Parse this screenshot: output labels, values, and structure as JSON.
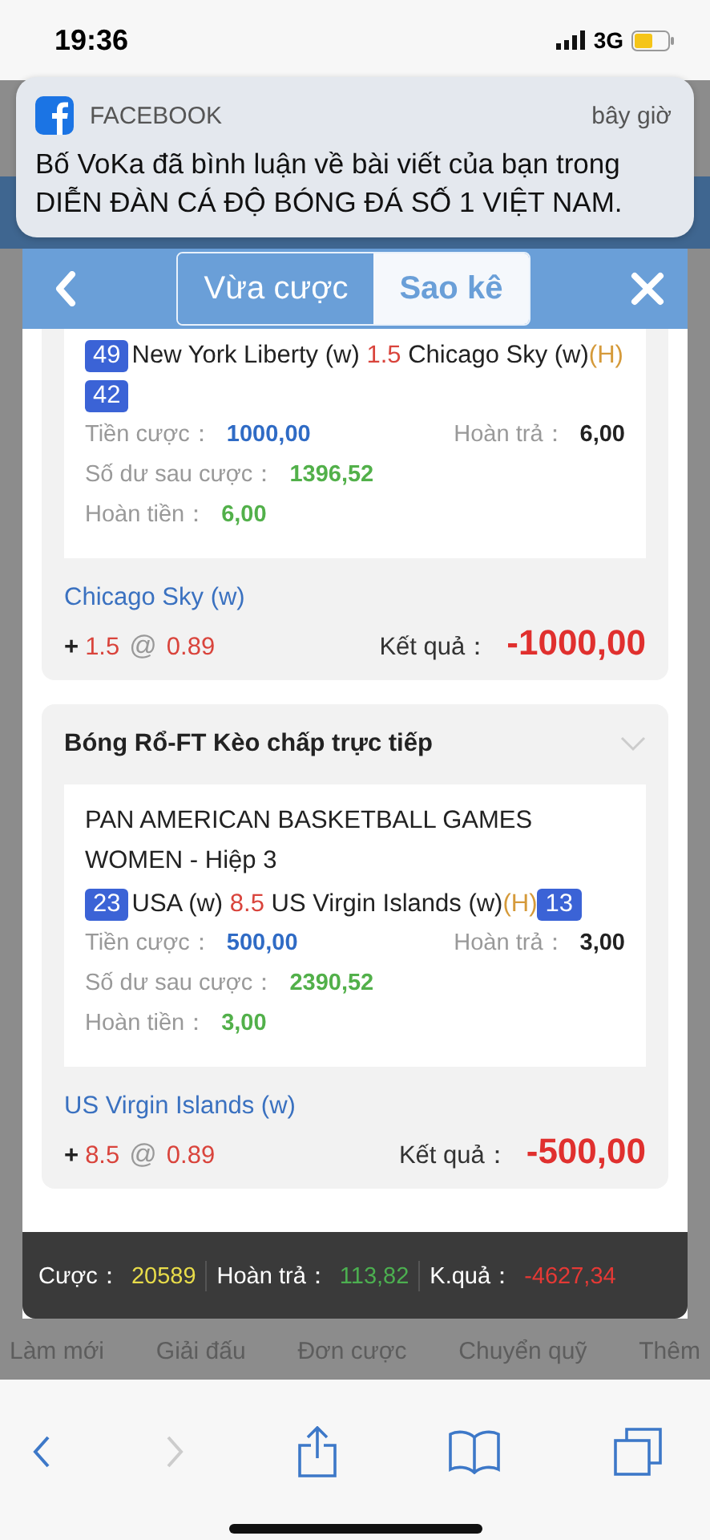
{
  "status_bar": {
    "time": "19:36",
    "network": "3G"
  },
  "notification": {
    "app": "FACEBOOK",
    "time": "bây giờ",
    "message": "Bố VoKa đã bình luận về bài viết của bạn trong DIỄN ĐÀN CÁ ĐỘ BÓNG ĐÁ SỐ 1 VIỆT NAM."
  },
  "modal": {
    "tabs": [
      {
        "label": "Vừa cược",
        "selected": false
      },
      {
        "label": "Sao kê",
        "selected": true
      }
    ],
    "bets": [
      {
        "home_score": "49",
        "home": "New York Liberty (w)",
        "line": "1.5",
        "away": "Chicago Sky (w)",
        "away_mark": "(H)",
        "away_score": "42",
        "stake_label": "Tiền cược：",
        "stake": "1000,00",
        "refund_label": "Hoàn trả：",
        "refund": "6,00",
        "balance_label": "Số dư sau cược：",
        "balance": "1396,52",
        "cashback_label": "Hoàn tiền：",
        "cashback": "6,00",
        "pick": "Chicago Sky (w)",
        "sign": "+",
        "handicap": "1.5",
        "at": "@",
        "odds": "0.89",
        "result_label": "Kết quả：",
        "result": "-1000,00"
      },
      {
        "title": "Bóng Rổ-FT Kèo chấp trực tiếp",
        "league": "PAN AMERICAN BASKETBALL GAMES WOMEN - Hiệp 3",
        "home_score": "23",
        "home": "USA (w)",
        "line": "8.5",
        "away": "US Virgin Islands (w)",
        "away_mark": "(H)",
        "away_score": "13",
        "stake_label": "Tiền cược：",
        "stake": "500,00",
        "refund_label": "Hoàn trả：",
        "refund": "3,00",
        "balance_label": "Số dư sau cược：",
        "balance": "2390,52",
        "cashback_label": "Hoàn tiền：",
        "cashback": "3,00",
        "pick": "US Virgin Islands (w)",
        "sign": "+",
        "handicap": "8.5",
        "at": "@",
        "odds": "0.89",
        "result_label": "Kết quả：",
        "result": "-500,00"
      }
    ],
    "summary": [
      {
        "label": "Cược：",
        "value": "20589",
        "color": "#e8dc4a"
      },
      {
        "label": "Hoàn trả：",
        "value": "113,82",
        "color": "#4caf50"
      },
      {
        "label": "K.quả：",
        "value": "-4627,34",
        "color": "#e53935"
      }
    ]
  },
  "bottom_nav": [
    "Làm mới",
    "Giải đấu",
    "Đơn cược",
    "Chuyển quỹ",
    "Thêm"
  ]
}
